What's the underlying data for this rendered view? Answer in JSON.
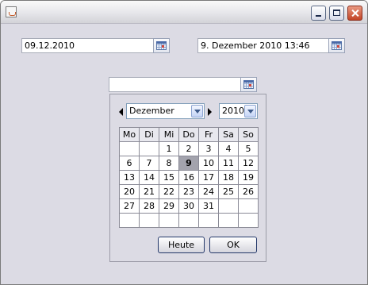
{
  "window": {
    "title": ""
  },
  "fields": {
    "date_short": "09.12.2010",
    "date_long": "9. Dezember 2010 13:46",
    "popup_input": ""
  },
  "calendar": {
    "month": "Dezember",
    "year": "2010",
    "weekdays": [
      "Mo",
      "Di",
      "Mi",
      "Do",
      "Fr",
      "Sa",
      "So"
    ],
    "weeks": [
      [
        "",
        "",
        "1",
        "2",
        "3",
        "4",
        "5"
      ],
      [
        "6",
        "7",
        "8",
        "9",
        "10",
        "11",
        "12"
      ],
      [
        "13",
        "14",
        "15",
        "16",
        "17",
        "18",
        "19"
      ],
      [
        "20",
        "21",
        "22",
        "23",
        "24",
        "25",
        "26"
      ],
      [
        "27",
        "28",
        "29",
        "30",
        "31",
        "",
        ""
      ],
      [
        "",
        "",
        "",
        "",
        "",
        "",
        ""
      ]
    ],
    "selected_day": "9",
    "today_button": "Heute",
    "ok_button": "OK"
  },
  "colors": {
    "window_background": "#dcdbe4",
    "selected_day_background": "#a3a3ad",
    "close_button": "#c24426"
  },
  "icons": [
    "java-app-icon",
    "minimize-icon",
    "maximize-icon",
    "close-icon",
    "calendar-icon",
    "prev-month-icon",
    "next-month-icon",
    "chevron-down-icon"
  ]
}
